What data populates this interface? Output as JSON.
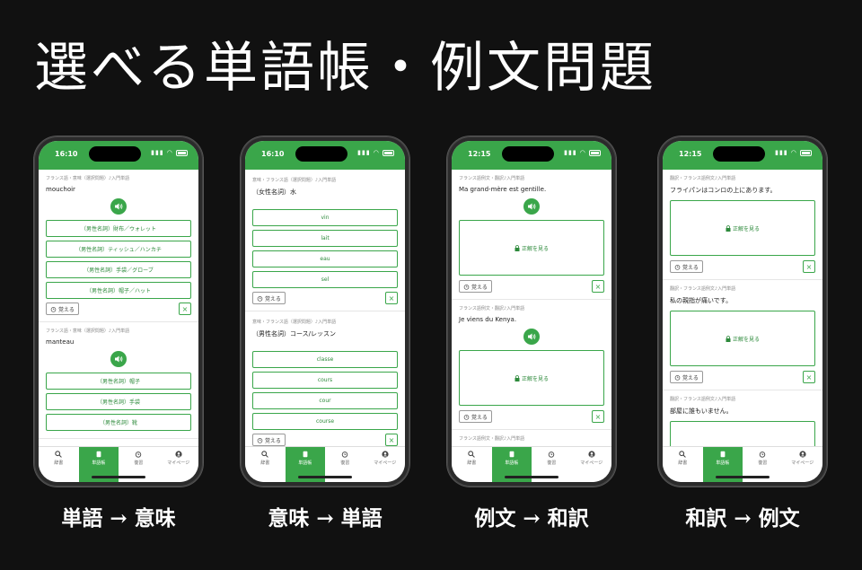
{
  "headline": "選べる単語帳・例文問題",
  "colors": {
    "accent": "#3aa64a",
    "background": "#111111"
  },
  "tabs": [
    "辞書",
    "単語帳",
    "復習",
    "マイページ"
  ],
  "remember_label": "覚える",
  "reveal_label": "正解を見る",
  "phones": [
    {
      "time": "16:10",
      "caption": "単語 → 意味",
      "cards": [
        {
          "crumb": "フランス語・意味（選択問題）♪入門単語",
          "prompt": "mouchoir",
          "choices": [
            "（男性名詞）財布／ウォレット",
            "（男性名詞）ティッシュ／ハンカチ",
            "（男性名詞）手袋／グローブ",
            "（男性名詞）帽子／ハット"
          ]
        },
        {
          "crumb": "フランス語・意味（選択問題）♪入門単語",
          "prompt": "manteau",
          "choices": [
            "（男性名詞）帽子",
            "（男性名詞）手袋",
            "（男性名詞）靴"
          ]
        }
      ]
    },
    {
      "time": "16:10",
      "caption": "意味 → 単語",
      "cards": [
        {
          "crumb": "意味・フランス語（選択問題）♪入門単語",
          "prompt": "（女性名詞）水",
          "choices": [
            "vin",
            "lait",
            "eau",
            "sel"
          ]
        },
        {
          "crumb": "意味・フランス語（選択問題）♪入門単語",
          "prompt": "（男性名詞）コース/レッスン",
          "choices": [
            "classe",
            "cours",
            "cour",
            "course"
          ]
        }
      ]
    },
    {
      "time": "12:15",
      "caption": "例文 → 和訳",
      "cards": [
        {
          "crumb": "フランス語例文・翻訳♪入門単語",
          "prompt": "Ma grand-mère est gentille."
        },
        {
          "crumb": "フランス語例文・翻訳♪入門単語",
          "prompt": "Je viens du Kenya."
        },
        {
          "crumb": "フランス語例文・翻訳♪入門単語",
          "prompt": ""
        }
      ]
    },
    {
      "time": "12:15",
      "caption": "和訳 → 例文",
      "cards": [
        {
          "crumb": "翻訳・フランス語例文♪入門単語",
          "prompt": "フライパンはコンロの上にあります。"
        },
        {
          "crumb": "翻訳・フランス語例文♪入門単語",
          "prompt": "私の親指が痛いです。"
        },
        {
          "crumb": "翻訳・フランス語例文♪入門単語",
          "prompt": "部屋に誰もいません。"
        }
      ]
    }
  ]
}
